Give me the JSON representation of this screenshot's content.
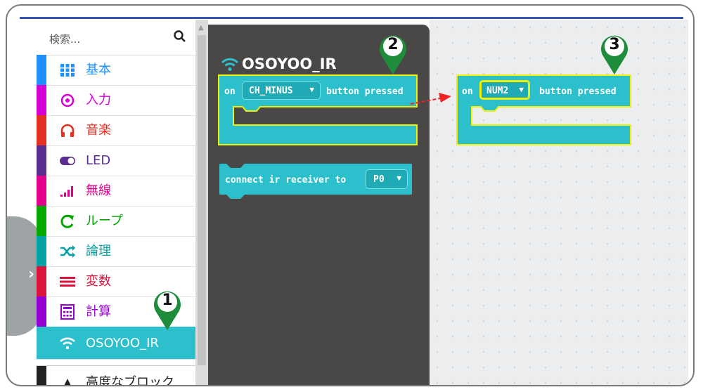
{
  "search": {
    "placeholder": "検索..."
  },
  "categories": [
    {
      "label": "基本",
      "icon": "grid-icon",
      "color": "#1e90ff"
    },
    {
      "label": "入力",
      "icon": "target-icon",
      "color": "#d400d4"
    },
    {
      "label": "音楽",
      "icon": "headphones-icon",
      "color": "#e63022"
    },
    {
      "label": "LED",
      "icon": "toggle-icon",
      "color": "#5c2d91"
    },
    {
      "label": "無線",
      "icon": "signal-icon",
      "color": "#e3008c"
    },
    {
      "label": "ループ",
      "icon": "loop-icon",
      "color": "#00aa00"
    },
    {
      "label": "論理",
      "icon": "shuffle-icon",
      "color": "#00a4a6"
    },
    {
      "label": "変数",
      "icon": "list-icon",
      "color": "#dc143c"
    },
    {
      "label": "計算",
      "icon": "calculator-icon",
      "color": "#9400d3"
    },
    {
      "label": "OSOYOO_IR",
      "icon": "wifi-icon",
      "color": "#2cc0cc"
    },
    {
      "label": "高度なブロック",
      "icon": "chevron-up-icon",
      "color": "#222222"
    }
  ],
  "flyout": {
    "title": "OSOYOO_IR",
    "block1": {
      "on": "on",
      "dropdown": "CH_MINUS",
      "suffix": "button pressed"
    },
    "block2": {
      "text": "connect ir receiver to",
      "dropdown": "P0"
    }
  },
  "workspace": {
    "block": {
      "on": "on",
      "dropdown": "NUM2",
      "suffix": "button pressed"
    }
  },
  "markers": [
    "1",
    "2",
    "3"
  ],
  "colors": {
    "block": "#2cc0cc",
    "highlight": "#f0f000",
    "marker": "#1e8c3a",
    "arrow": "#ee2222"
  }
}
